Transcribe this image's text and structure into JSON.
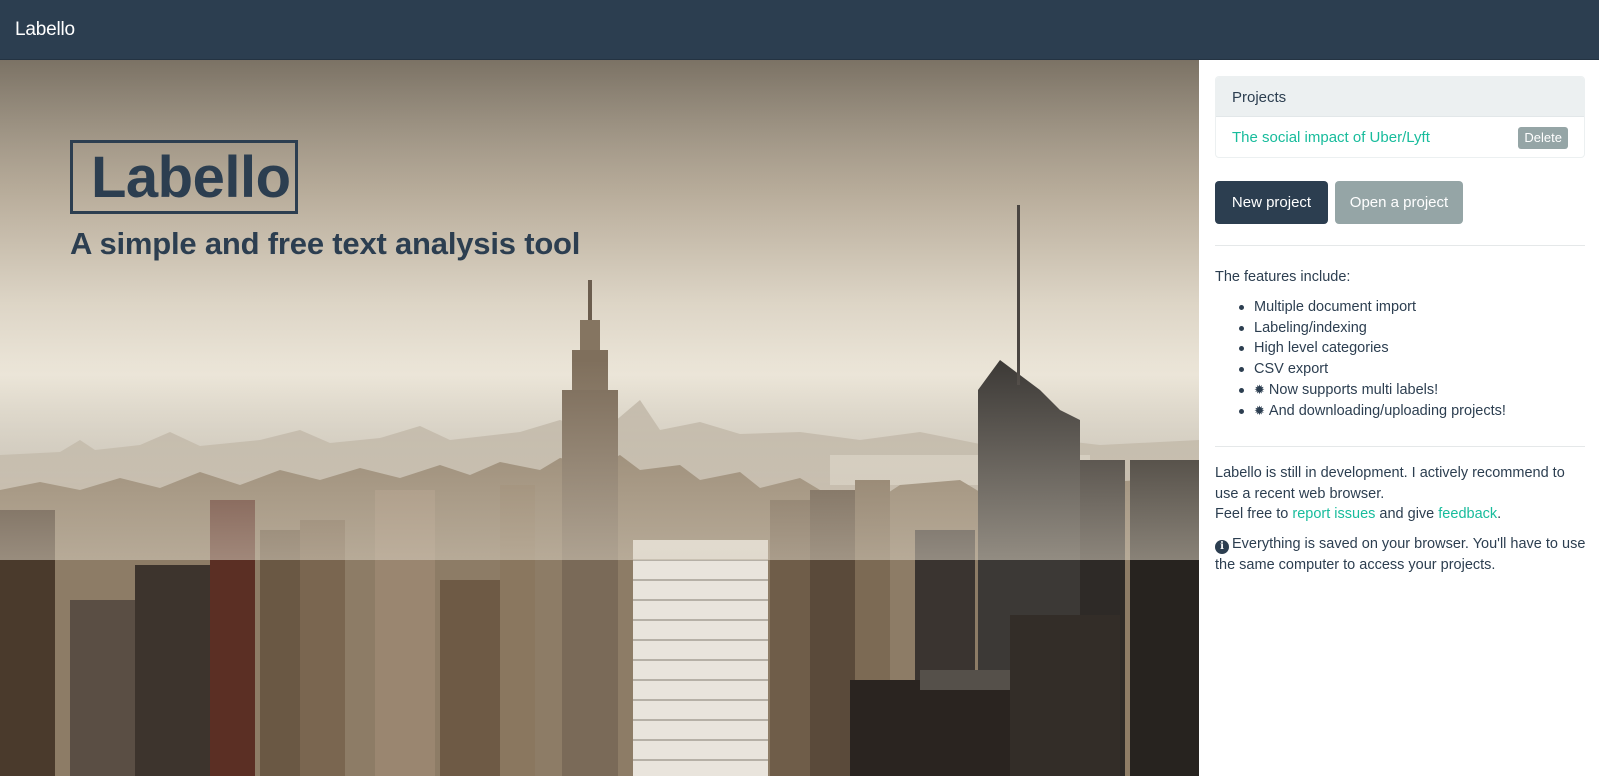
{
  "navbar": {
    "brand": "Labello"
  },
  "hero": {
    "title": "Labello",
    "subtitle": "A simple and free text analysis tool",
    "image": "city-skyline-photo"
  },
  "sidebar": {
    "projects_panel": {
      "title": "Projects",
      "items": [
        {
          "name": "The social impact of Uber/Lyft",
          "delete_label": "Delete"
        }
      ]
    },
    "buttons": {
      "new_project": "New project",
      "open_project": "Open a project"
    },
    "features": {
      "intro": "The features include:",
      "items": [
        "Multiple document import",
        "Labeling/indexing",
        "High level categories",
        "CSV export",
        "Now supports multi labels!",
        "And downloading/uploading projects!"
      ]
    },
    "info": {
      "dev_notice": "Labello is still in development. I actively recommend to use a recent web browser.",
      "feedback_prefix": "Feel free to",
      "report_link": "report issues",
      "feedback_middle": "and give",
      "feedback_link": "feedback",
      "feedback_suffix": ".",
      "saved_notice": "Everything is saved on your browser. You'll have to use the same computer to access your projects."
    }
  },
  "colors": {
    "primary": "#2c3e50",
    "accent": "#18bc9c",
    "muted": "#95a5a6",
    "panel_bg": "#ecf0f1"
  },
  "icons": {
    "feature_new": "starburst-icon",
    "info": "info-circle-icon"
  }
}
